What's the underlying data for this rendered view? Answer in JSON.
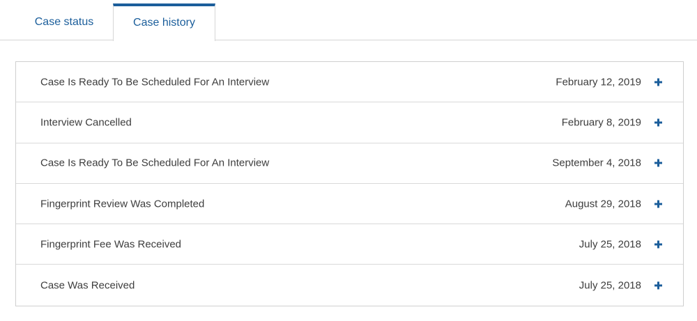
{
  "tabs": {
    "status_label": "Case status",
    "history_label": "Case history",
    "active": "Case history"
  },
  "history": {
    "events": [
      {
        "title": "Case Is Ready To Be Scheduled For An Interview",
        "date": "February 12, 2019",
        "icon": "plus-icon"
      },
      {
        "title": "Interview Cancelled",
        "date": "February 8, 2019",
        "icon": "plus-icon"
      },
      {
        "title": "Case Is Ready To Be Scheduled For An Interview",
        "date": "September 4, 2018",
        "icon": "plus-icon"
      },
      {
        "title": "Fingerprint Review Was Completed",
        "date": "August 29, 2018",
        "icon": "plus-icon"
      },
      {
        "title": "Fingerprint Fee Was Received",
        "date": "July 25, 2018",
        "icon": "plus-icon"
      },
      {
        "title": "Case Was Received",
        "date": "July 25, 2018",
        "icon": "plus-icon"
      }
    ]
  },
  "colors": {
    "accent": "#1b5e9b",
    "border": "#d6d6d6",
    "text": "#3d3d3d"
  }
}
